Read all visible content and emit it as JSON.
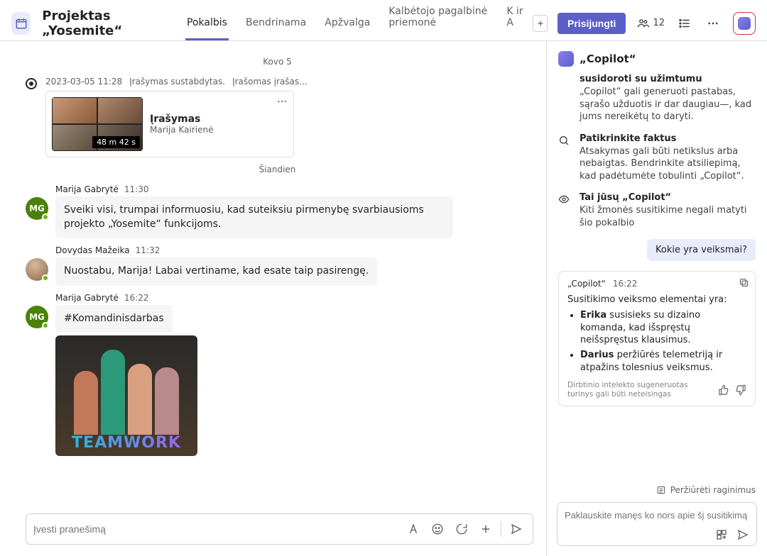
{
  "header": {
    "title": "Projektas „Yosemite“",
    "tabs": [
      "Pokalbis",
      "Bendrinama",
      "Apžvalga",
      "Kalbėtojo pagalbinė priemonė",
      "K ir A"
    ],
    "activeTab": 0,
    "joinLabel": "Prisijungti",
    "participantCount": "12"
  },
  "chat": {
    "divider1": "Kovo 5",
    "recording": {
      "timestamp": "2023-03-05 11:28",
      "statusA": "Įrašymas sustabdytas.",
      "statusB": "Įrašomas įrašas...",
      "title": "Įrašymas",
      "subtitle": "Marija Kairienė",
      "duration": "48 m 42 s"
    },
    "divider2": "Šiandien",
    "messages": [
      {
        "author": "Marija Gabrytė",
        "time": "11:30",
        "initials": "MG",
        "avatarClass": "green",
        "text": "Sveiki visi, trumpai informuosiu, kad suteiksiu pirmenybę svarbiausioms projekto „Yosemite“ funkcijoms."
      },
      {
        "author": "Dovydas Mažeika",
        "time": "11:32",
        "initials": "",
        "avatarClass": "photo",
        "text": "Nuostabu, Marija! Labai vertiname, kad esate taip pasirengę."
      },
      {
        "author": "Marija Gabrytė",
        "time": "16:22",
        "initials": "MG",
        "avatarClass": "green",
        "text": "#Komandinisdarbas",
        "gif": true,
        "gifText": "TEAMWORK"
      }
    ],
    "composePlaceholder": "Įvesti pranešimą"
  },
  "copilot": {
    "title": "„Copilot“",
    "tips": [
      {
        "icon": "sparkle",
        "title": "susidoroti su užimtumu",
        "text": "„Copilot“ gali generuoti pastabas, sąrašo užduotis ir dar daugiau—, kad jums nereikėtų to daryti."
      },
      {
        "icon": "search",
        "title": "Patikrinkite faktus",
        "text": "Atsakymas gali būti netikslus arba nebaigtas. Bendrinkite atsiliepimą, kad padėtumėte tobulinti „Copilot“."
      },
      {
        "icon": "eye",
        "title": "Tai jūsų „Copilot“",
        "text": "Kiti žmonės susitikime negali matyti šio pokalbio"
      }
    ],
    "userQuery": "Kokie yra veiksmai?",
    "response": {
      "author": "„Copilot“",
      "time": "16:22",
      "intro": "Susitikimo veiksmo elementai yra:",
      "items": [
        {
          "bold": "Erika",
          "rest": " susisieks su dizaino komanda, kad išspręstų neišspręstus klausimus."
        },
        {
          "bold": "Darius",
          "rest": " peržiūrės telemetriją ir atpažins tolesnius veiksmus."
        }
      ],
      "disclaimer": "Dirbtinio intelekto sugeneruotas turinys gali būti neteisingas"
    },
    "promptsLink": "Peržiūrėti raginimus",
    "composePlaceholder": "Paklauskite manęs ko nors apie šį susitikimą"
  }
}
